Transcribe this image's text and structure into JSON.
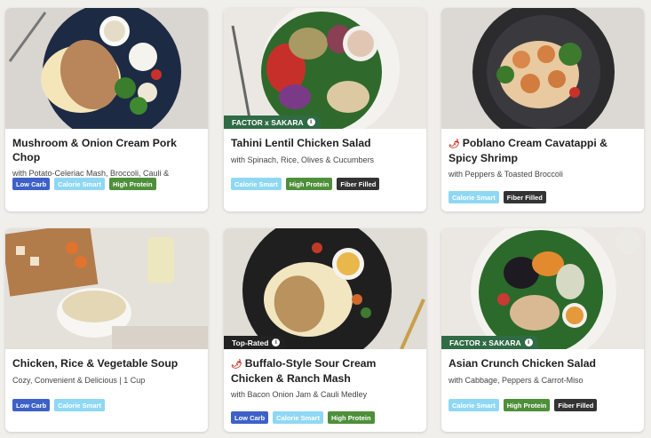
{
  "cards": [
    {
      "title": "Mushroom & Onion Cream Pork Chop",
      "subtitle": "with Potato-Celeriac Mash, Broccoli, Cauli & Peppers",
      "tags": [
        "Low Carb",
        "Calorie Smart",
        "High Protein"
      ]
    },
    {
      "title": "Tahini Lentil Chicken Salad",
      "subtitle": "with Spinach, Rice, Olives & Cucumbers",
      "badge": "FACTOR x SAKARA",
      "tags": [
        "Calorie Smart",
        "High Protein",
        "Fiber Filled"
      ]
    },
    {
      "title": "Poblano Cream Cavatappi & Spicy Shrimp",
      "subtitle": "with Peppers & Toasted Broccoli",
      "spicy_icon": "chili-pepper-icon",
      "tags": [
        "Calorie Smart",
        "Fiber Filled"
      ]
    },
    {
      "title": "Chicken, Rice & Vegetable Soup",
      "subtitle": "Cozy, Convenient & Delicious | 1 Cup",
      "tags": [
        "Low Carb",
        "Calorie Smart"
      ]
    },
    {
      "title": "Buffalo-Style Sour Cream Chicken & Ranch Mash",
      "subtitle": "with Bacon Onion Jam & Cauli Medley",
      "badge": "Top-Rated",
      "spicy_icon": "chili-pepper-icon",
      "tags": [
        "Low Carb",
        "Calorie Smart",
        "High Protein"
      ]
    },
    {
      "title": "Asian Crunch Chicken Salad",
      "subtitle": "with Cabbage, Peppers & Carrot-Miso",
      "badge": "FACTOR x SAKARA",
      "tags": [
        "Calorie Smart",
        "High Protein",
        "Fiber Filled"
      ]
    }
  ],
  "icons": {
    "info": "info-icon",
    "spicy": "chili-pepper-icon"
  },
  "colors": {
    "low_carb": "#3e61c8",
    "calorie_smart": "#8fd8f4",
    "high_protein": "#4e8f3a",
    "fiber_filled": "#333333",
    "sakara_badge": "#2f6b45",
    "top_rated_badge": "#222222"
  }
}
